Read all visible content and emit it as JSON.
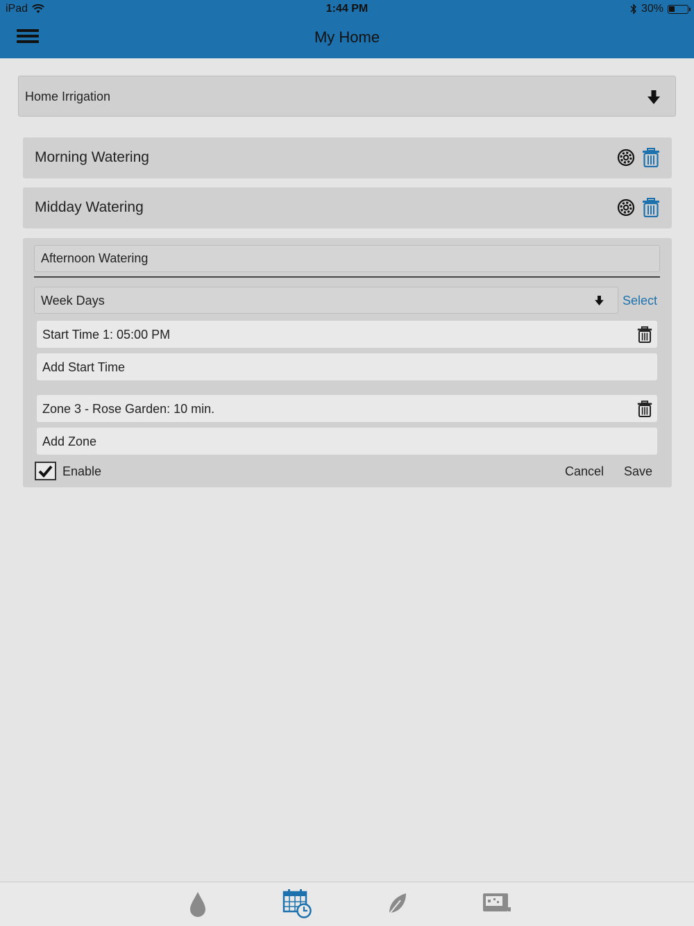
{
  "status_bar": {
    "device": "iPad",
    "time": "1:44 PM",
    "battery": "30%",
    "battery_level": 0.3
  },
  "header": {
    "title": "My Home",
    "color": "#1d72ad"
  },
  "controller": {
    "selected": "Home Irrigation"
  },
  "programs": [
    {
      "label": "Morning Watering"
    },
    {
      "label": "Midday Watering"
    }
  ],
  "edit": {
    "name_value": "Afternoon Watering",
    "days_selected": "Week Days",
    "select_link": "Select",
    "start_times": [
      "Start Time 1: 05:00 PM"
    ],
    "add_start_time": "Add Start Time",
    "zones": [
      "Zone 3 - Rose Garden: 10 min."
    ],
    "add_zone": "Add Zone",
    "enable_label": "Enable",
    "enabled": true,
    "cancel": "Cancel",
    "save": "Save"
  },
  "tabs": [
    {
      "icon": "water-drop-icon",
      "active": false
    },
    {
      "icon": "calendar-clock-icon",
      "active": true
    },
    {
      "icon": "leaf-icon",
      "active": false
    },
    {
      "icon": "controller-icon",
      "active": false
    }
  ],
  "colors": {
    "accent": "#1d72ad",
    "tab_inactive": "#8a8a8a"
  }
}
